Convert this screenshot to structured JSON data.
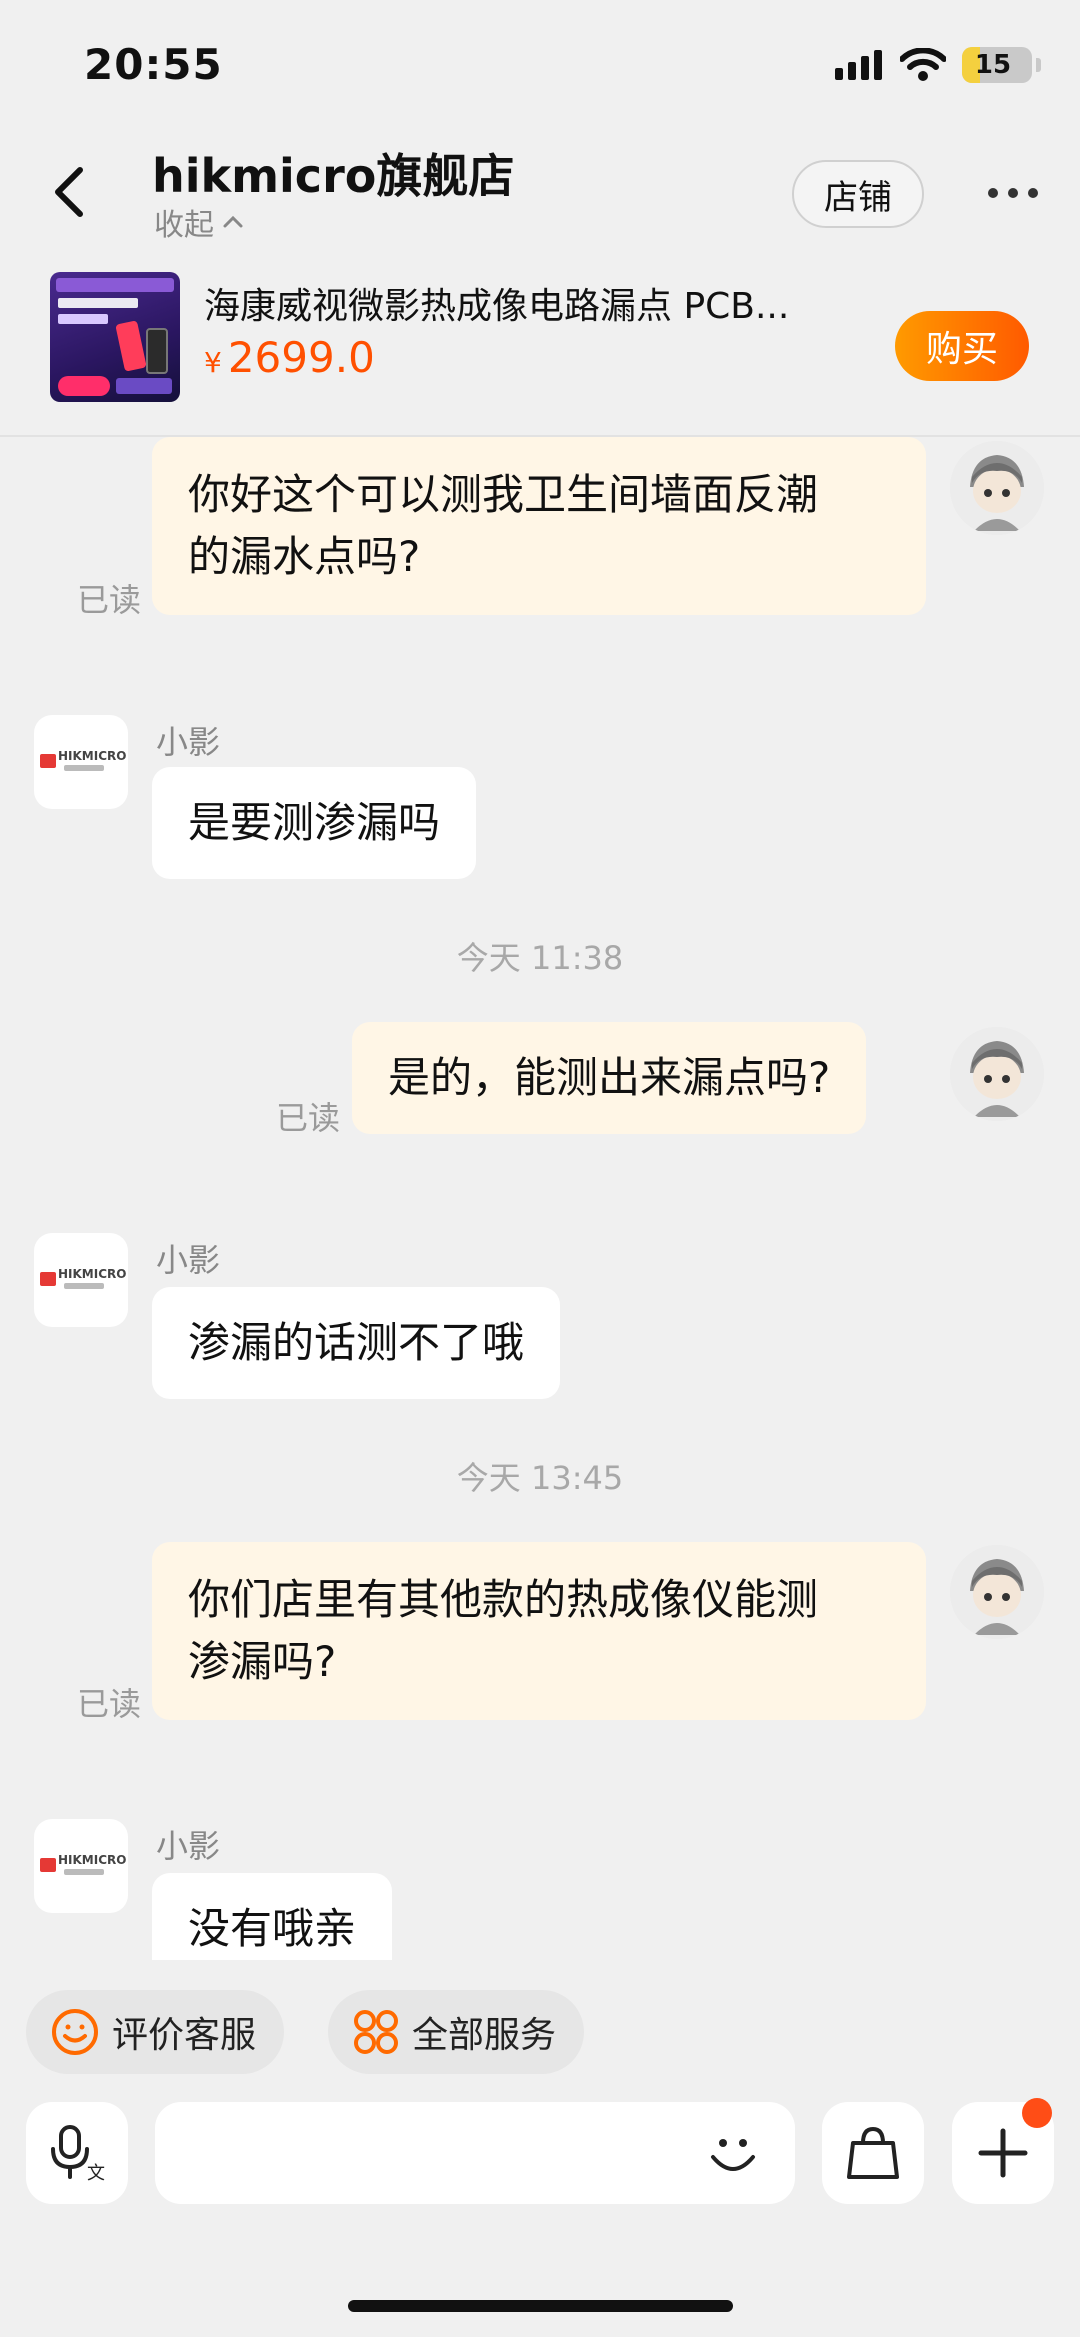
{
  "status_bar": {
    "time": "20:55",
    "battery_level": "15",
    "icons": [
      "signal-icon",
      "wifi-icon",
      "battery-icon"
    ]
  },
  "header": {
    "shop_name": "hikmicro旗舰店",
    "collapse_label": "收起",
    "store_button": "店铺",
    "icons": [
      "back-arrow-icon",
      "more-icon",
      "chevron-up-icon"
    ]
  },
  "product": {
    "title": "海康威视微影热成像电路漏点 PCB...",
    "currency": "¥",
    "price": "2699.0",
    "buy_button": "购买"
  },
  "chat": {
    "shop_sender": "小影",
    "read_label": "已读",
    "timestamps": [
      "今天 11:38",
      "今天 13:45"
    ],
    "messages": [
      {
        "from": "me",
        "line1": "你好这个可以测我卫生间墙面反潮",
        "line2": "的漏水点吗?"
      },
      {
        "from": "shop",
        "text": "是要测渗漏吗"
      },
      {
        "from": "me",
        "text": "是的，能测出来漏点吗?"
      },
      {
        "from": "shop",
        "text": "渗漏的话测不了哦"
      },
      {
        "from": "me",
        "line1": "你们店里有其他款的热成像仪能测",
        "line2": "渗漏吗?"
      },
      {
        "from": "shop",
        "text": "没有哦亲"
      }
    ],
    "shop_logo_text": "HIKMICRO"
  },
  "quick_actions": {
    "rate": "评价客服",
    "all_services": "全部服务"
  },
  "input_bar": {
    "icons": [
      "voice-input-icon",
      "emoji-icon",
      "shopping-bag-icon",
      "plus-icon"
    ],
    "accent": "#ff5000"
  }
}
